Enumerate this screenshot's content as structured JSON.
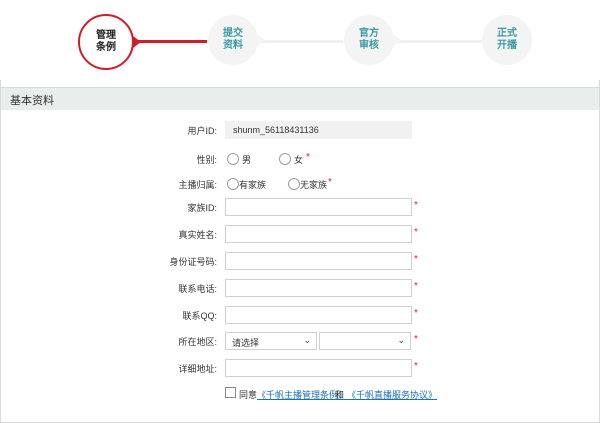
{
  "steps": [
    {
      "line1": "管理",
      "line2": "条例"
    },
    {
      "line1": "提交",
      "line2": "资料"
    },
    {
      "line1": "官方",
      "line2": "审核"
    },
    {
      "line1": "正式",
      "line2": "开播"
    }
  ],
  "section": {
    "title": "基本资料"
  },
  "form": {
    "user_id": {
      "label": "用户ID:",
      "value": "shunm_56118431136"
    },
    "gender": {
      "label": "性别:",
      "option_male": "男",
      "option_female": "女"
    },
    "affiliation": {
      "label": "主播归属:",
      "option_family": "有家族",
      "option_none": "无家族"
    },
    "family_id": {
      "label": "家族ID:"
    },
    "real_name": {
      "label": "真实姓名:"
    },
    "id_number": {
      "label": "身份证号码:"
    },
    "phone": {
      "label": "联系电话:"
    },
    "qq": {
      "label": "联系QQ:"
    },
    "region": {
      "label": "所在地区:",
      "province_selected": "请选择",
      "city_selected": ""
    },
    "address": {
      "label": "详细地址:"
    },
    "required_mark": "*"
  },
  "agreement": {
    "prefix": "同意",
    "link1": "《千帆主播管理条例》",
    "conjunction": "和",
    "link2": "《千帆直播服务协议》"
  },
  "colors": {
    "accent": "#cc1f2a",
    "step_text": "#3a9aa3",
    "section_bg": "#e8eeeb",
    "link": "#1a6fb5"
  }
}
